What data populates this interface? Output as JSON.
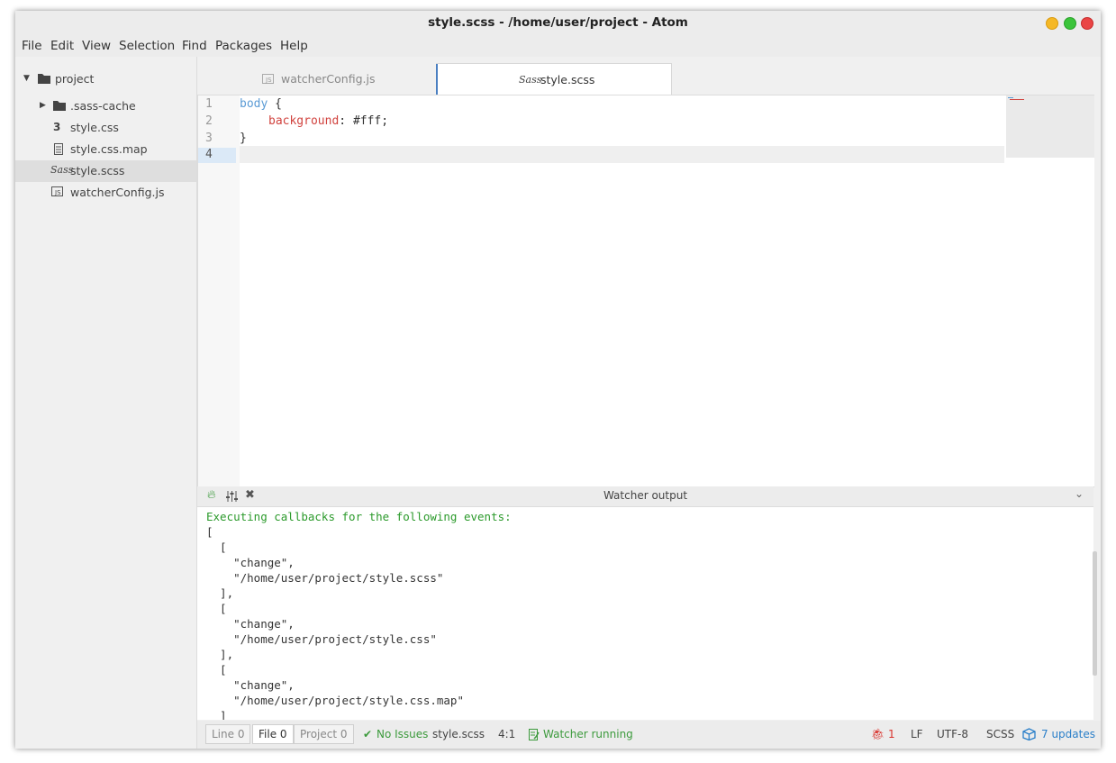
{
  "window": {
    "title": "style.scss - /home/user/project - Atom"
  },
  "menu": [
    "File",
    "Edit",
    "View",
    "Selection",
    "Find",
    "Packages",
    "Help"
  ],
  "tree": {
    "root": "project",
    "items": [
      {
        "label": ".sass-cache",
        "icon": "folder-icon"
      },
      {
        "label": "style.css",
        "icon": "css-file-icon"
      },
      {
        "label": "style.css.map",
        "icon": "text-file-icon"
      },
      {
        "label": "style.scss",
        "icon": "sass-file-icon"
      },
      {
        "label": "watcherConfig.js",
        "icon": "js-file-icon"
      }
    ]
  },
  "tabs": [
    {
      "label": "watcherConfig.js",
      "icon": "js-file-icon"
    },
    {
      "label": "style.scss",
      "icon": "sass-file-icon"
    }
  ],
  "editor": {
    "line_numbers": [
      "1",
      "2",
      "3",
      "4"
    ],
    "lines": {
      "l1_selector": "body",
      "l1_brace": " {",
      "l2_prop": "background",
      "l2_colon": ": ",
      "l2_value": "#fff;",
      "l3": "}"
    }
  },
  "panel": {
    "title": "Watcher output",
    "lines": [
      "Executing callbacks for the following events:",
      "[",
      "  [",
      "    \"change\",",
      "    \"/home/user/project/style.scss\"",
      "  ],",
      "  [",
      "    \"change\",",
      "    \"/home/user/project/style.css\"",
      "  ],",
      "  [",
      "    \"change\",",
      "    \"/home/user/project/style.css.map\"",
      "  ]"
    ]
  },
  "status": {
    "line": "Line 0",
    "file": "File 0",
    "project": "Project 0",
    "issues": "No Issues",
    "filename": "style.scss",
    "cursor": "4:1",
    "watcher": "Watcher running",
    "bugs": "1",
    "line_ending": "LF",
    "encoding": "UTF-8",
    "grammar": "SCSS",
    "updates": "7 updates"
  },
  "colors": {
    "accent": "#4a7fc1",
    "ok_green": "#3c9a3c",
    "console_green": "#2b9a2b",
    "keyword": "#5b9bd5",
    "property": "#d1433f",
    "error_red": "#d9312b",
    "link_blue": "#2a7fc9"
  }
}
